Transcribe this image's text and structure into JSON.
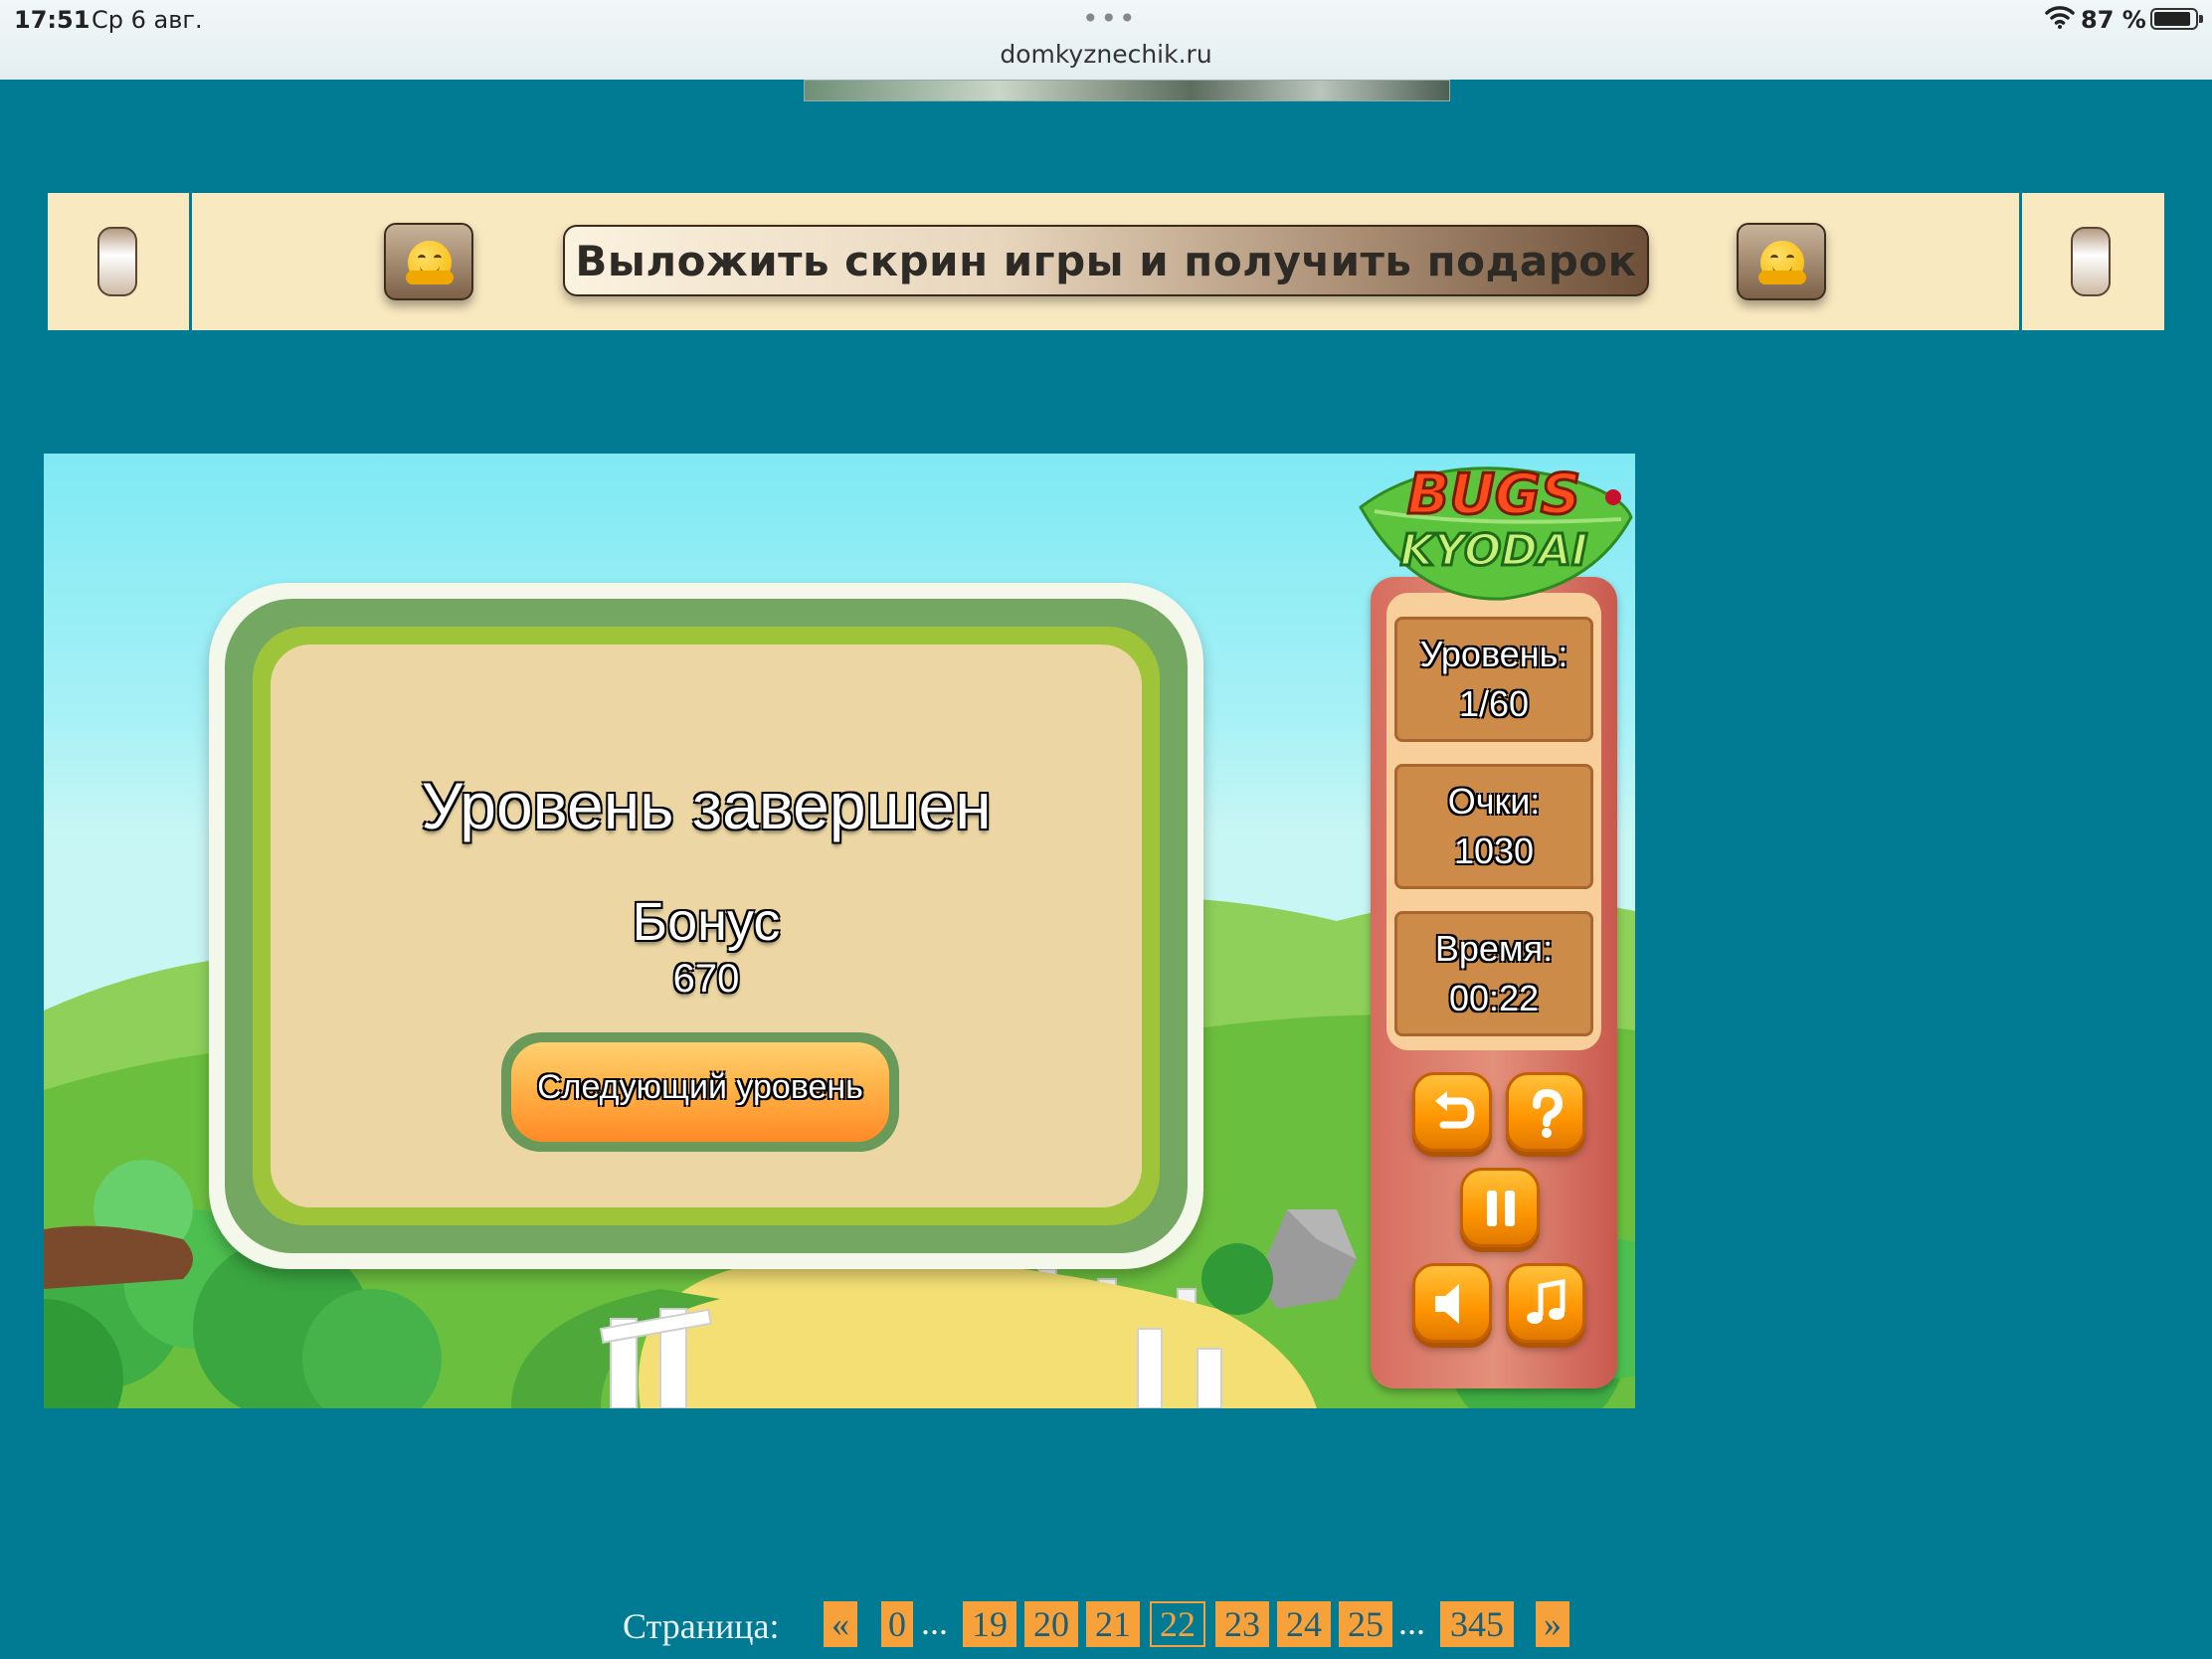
{
  "status_bar": {
    "time": "17:51",
    "date": "Ср 6 авг.",
    "url": "domkyznechik.ru",
    "battery_percent": "87 %",
    "battery_level": 0.87
  },
  "banner": {
    "share_label": "Выложить скрин игры и получить подарок",
    "left_icon": "hugging-face-emoji",
    "right_icon": "hugging-face-emoji"
  },
  "game": {
    "logo_line1": "BUGS",
    "logo_line2": "KYODAI",
    "dialog": {
      "title": "Уровень завершен",
      "bonus_label": "Бонус",
      "bonus_value": "670",
      "next_button": "Следующий уровень"
    },
    "stats": {
      "level_label": "Уровень:",
      "level_value": "1/60",
      "score_label": "Очки:",
      "score_value": "1030",
      "time_label": "Время:",
      "time_value": "00:22"
    },
    "controls": [
      "undo-icon",
      "help-icon",
      "pause-icon",
      "sound-icon",
      "music-icon"
    ]
  },
  "pagination": {
    "label": "Страница:",
    "prev": "«",
    "next": "»",
    "ellipsis": "...",
    "pages": [
      "0",
      "19",
      "20",
      "21",
      "22",
      "23",
      "24",
      "25",
      "345"
    ],
    "current": "22"
  }
}
